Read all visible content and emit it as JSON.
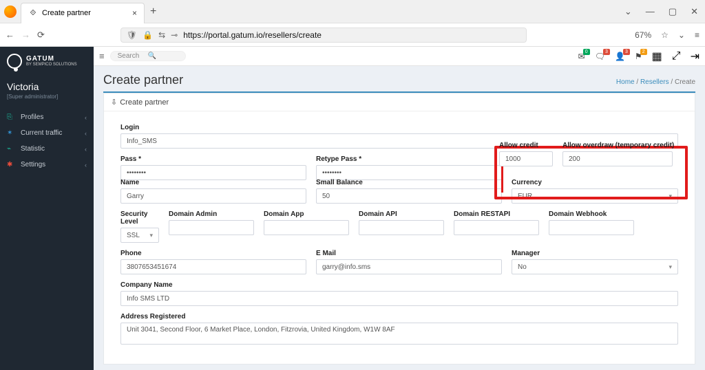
{
  "browser": {
    "tab_title": "Create partner",
    "url": "https://portal.gatum.io/resellers/create",
    "zoom": "67%"
  },
  "sidebar": {
    "brand_t1": "GATUM",
    "brand_t2": "BY SEMPICO SOLUTIONS",
    "user": "Victoria",
    "role": "[Super administrator]",
    "items": [
      {
        "label": "Profiles"
      },
      {
        "label": "Current traffic"
      },
      {
        "label": "Statistic"
      },
      {
        "label": "Settings"
      }
    ]
  },
  "topbar": {
    "search_ph": "Search",
    "badges": [
      "0",
      "3",
      "3",
      "2"
    ]
  },
  "page": {
    "title": "Create partner",
    "crumb_home": "Home",
    "crumb_resellers": "Resellers",
    "crumb_current": "Create",
    "box_title": "Create partner"
  },
  "form": {
    "login_lbl": "Login",
    "login_val": "Info_SMS",
    "pass_lbl": "Pass *",
    "pass_val": "••••••••",
    "repass_lbl": "Retype Pass *",
    "repass_val": "••••••••",
    "credit_lbl": "Allow credit",
    "credit_val": "1000",
    "overdraw_lbl": "Allow overdraw (temporary credit)",
    "overdraw_val": "200",
    "name_lbl": "Name",
    "name_val": "Garry",
    "smallbal_lbl": "Small Balance",
    "smallbal_val": "50",
    "currency_lbl": "Currency",
    "currency_val": "EUR",
    "sec_lbl": "Security Level",
    "sec_val": "SSL",
    "dadmin_lbl": "Domain Admin",
    "dapp_lbl": "Domain App",
    "dapi_lbl": "Domain API",
    "drest_lbl": "Domain RESTAPI",
    "dweb_lbl": "Domain Webhook",
    "phone_lbl": "Phone",
    "phone_val": "3807653451674",
    "email_lbl": "E Mail",
    "email_val": "garry@info.sms",
    "manager_lbl": "Manager",
    "manager_val": "No",
    "company_lbl": "Company Name",
    "company_val": "Info SMS LTD",
    "addr_lbl": "Address Registered",
    "addr_val": "Unit 3041, Second Floor, 6 Market Place, London, Fitzrovia, United Kingdom, W1W 8AF"
  }
}
